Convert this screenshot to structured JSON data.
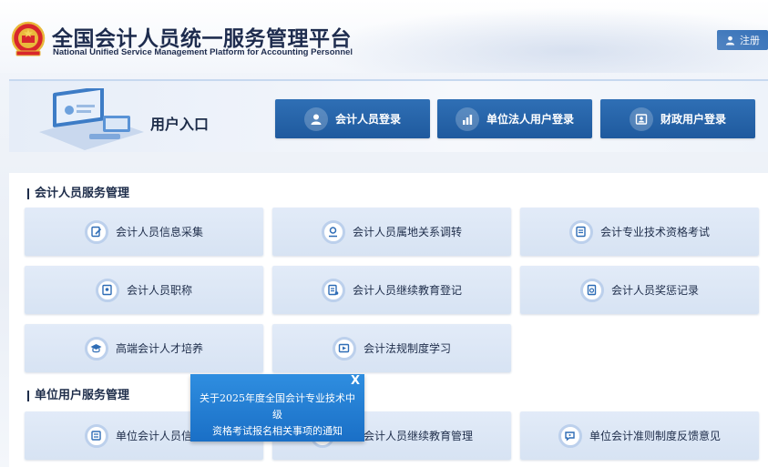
{
  "header": {
    "title_cn": "全国会计人员统一服务管理平台",
    "title_en": "National Unified Service Management Platform for Accounting Personnel",
    "register_label": "注册"
  },
  "entrance": {
    "title": "用户入口",
    "buttons": [
      {
        "label": "会计人员登录",
        "icon": "user-icon"
      },
      {
        "label": "单位法人用户登录",
        "icon": "building-chart-icon"
      },
      {
        "label": "财政用户登录",
        "icon": "id-card-icon"
      }
    ]
  },
  "sections": {
    "personnel": {
      "title": "会计人员服务管理",
      "items": [
        {
          "label": "会计人员信息采集",
          "icon": "edit-form-icon"
        },
        {
          "label": "会计人员属地关系调转",
          "icon": "location-transfer-icon"
        },
        {
          "label": "会计专业技术资格考试",
          "icon": "exam-paper-icon"
        },
        {
          "label": "会计人员职称",
          "icon": "certificate-icon"
        },
        {
          "label": "会计人员继续教育登记",
          "icon": "education-register-icon"
        },
        {
          "label": "会计人员奖惩记录",
          "icon": "award-record-icon"
        },
        {
          "label": "高端会计人才培养",
          "icon": "graduation-cap-icon"
        },
        {
          "label": "会计法规制度学习",
          "icon": "video-learning-icon"
        }
      ]
    },
    "unit": {
      "title": "单位用户服务管理",
      "items": [
        {
          "label": "单位会计人员信息",
          "icon": "unit-info-icon"
        },
        {
          "label": "单位会计人员继续教育管理",
          "icon": "unit-education-icon"
        },
        {
          "label": "单位会计准则制度反馈意见",
          "icon": "feedback-icon"
        }
      ]
    }
  },
  "notice": {
    "text_line1": "关于2025年度全国会计专业技术中级",
    "text_line2": "资格考试报名相关事项的通知",
    "close_label": "X"
  },
  "colors": {
    "primary_blue": "#2f6db6",
    "dark_text": "#1e2d4a",
    "card_bg": "#dce6f5",
    "notice_blue": "#2a86d8"
  }
}
